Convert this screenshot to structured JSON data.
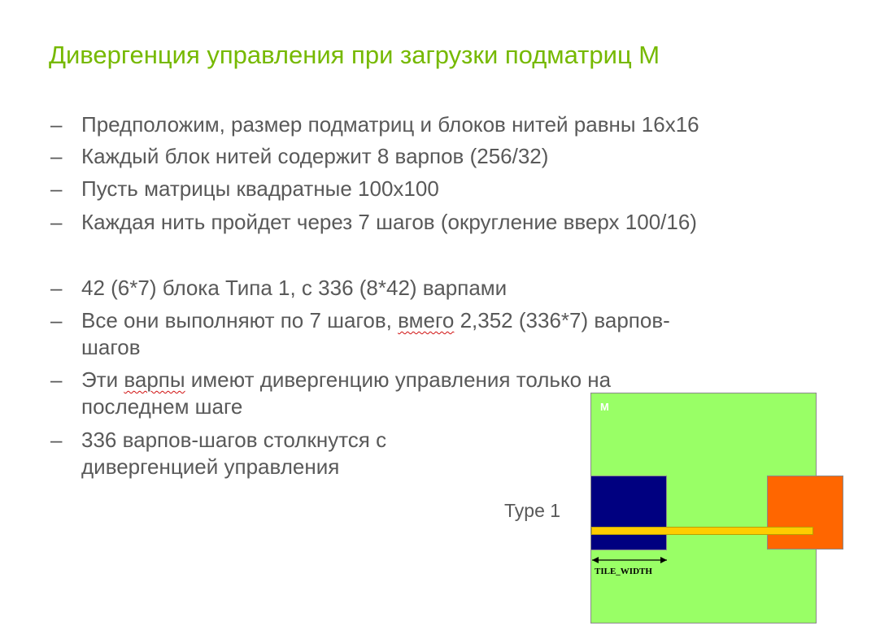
{
  "slide": {
    "title": "Дивергенция управления при загрузки подматриц M",
    "bullets": [
      {
        "dash": "–",
        "lines": [
          "Предположим, размер подматриц и блоков нитей равны 16x16"
        ]
      },
      {
        "dash": "–",
        "lines": [
          "Каждый блок нитей содержит 8 варпов (256/32)"
        ]
      },
      {
        "dash": "–",
        "lines": [
          "Пусть матрицы квадратные 100x100"
        ]
      },
      {
        "dash": "–",
        "lines": [
          "Каждая нить пройдет через 7 шагов (округление вверх 100/16)"
        ]
      },
      {
        "dash": "–",
        "lines": [
          "42 (6*7) блока Типа 1, с 336 (8*42) варпами"
        ]
      },
      {
        "dash": "–",
        "line1_pre": "Все они выполняют по 7 шагов, ",
        "line1_squiggle": "вмего",
        "line1_post": " 2,352 (336*7) варпов-",
        "line2": "шагов"
      },
      {
        "dash": "–",
        "line1_pre": "Эти ",
        "line1_squiggle": "варпы",
        "line1_post": " имеют дивергенцию управления только на",
        "line2": "последнем шаге"
      },
      {
        "dash": "–",
        "lines": [
          "336 варпов-шагов столкнутся с",
          "дивергенцией управления"
        ]
      }
    ]
  },
  "diagram": {
    "matrix_label": "M",
    "type_label": "Type 1",
    "tile_width_label": "TILE_WIDTH",
    "colors": {
      "title": "#76b900",
      "text": "#595959",
      "matrix_fill": "#99ff66",
      "tile_blue": "#000080",
      "tile_orange": "#ff6600",
      "row_bar": "#ffcc00"
    }
  }
}
